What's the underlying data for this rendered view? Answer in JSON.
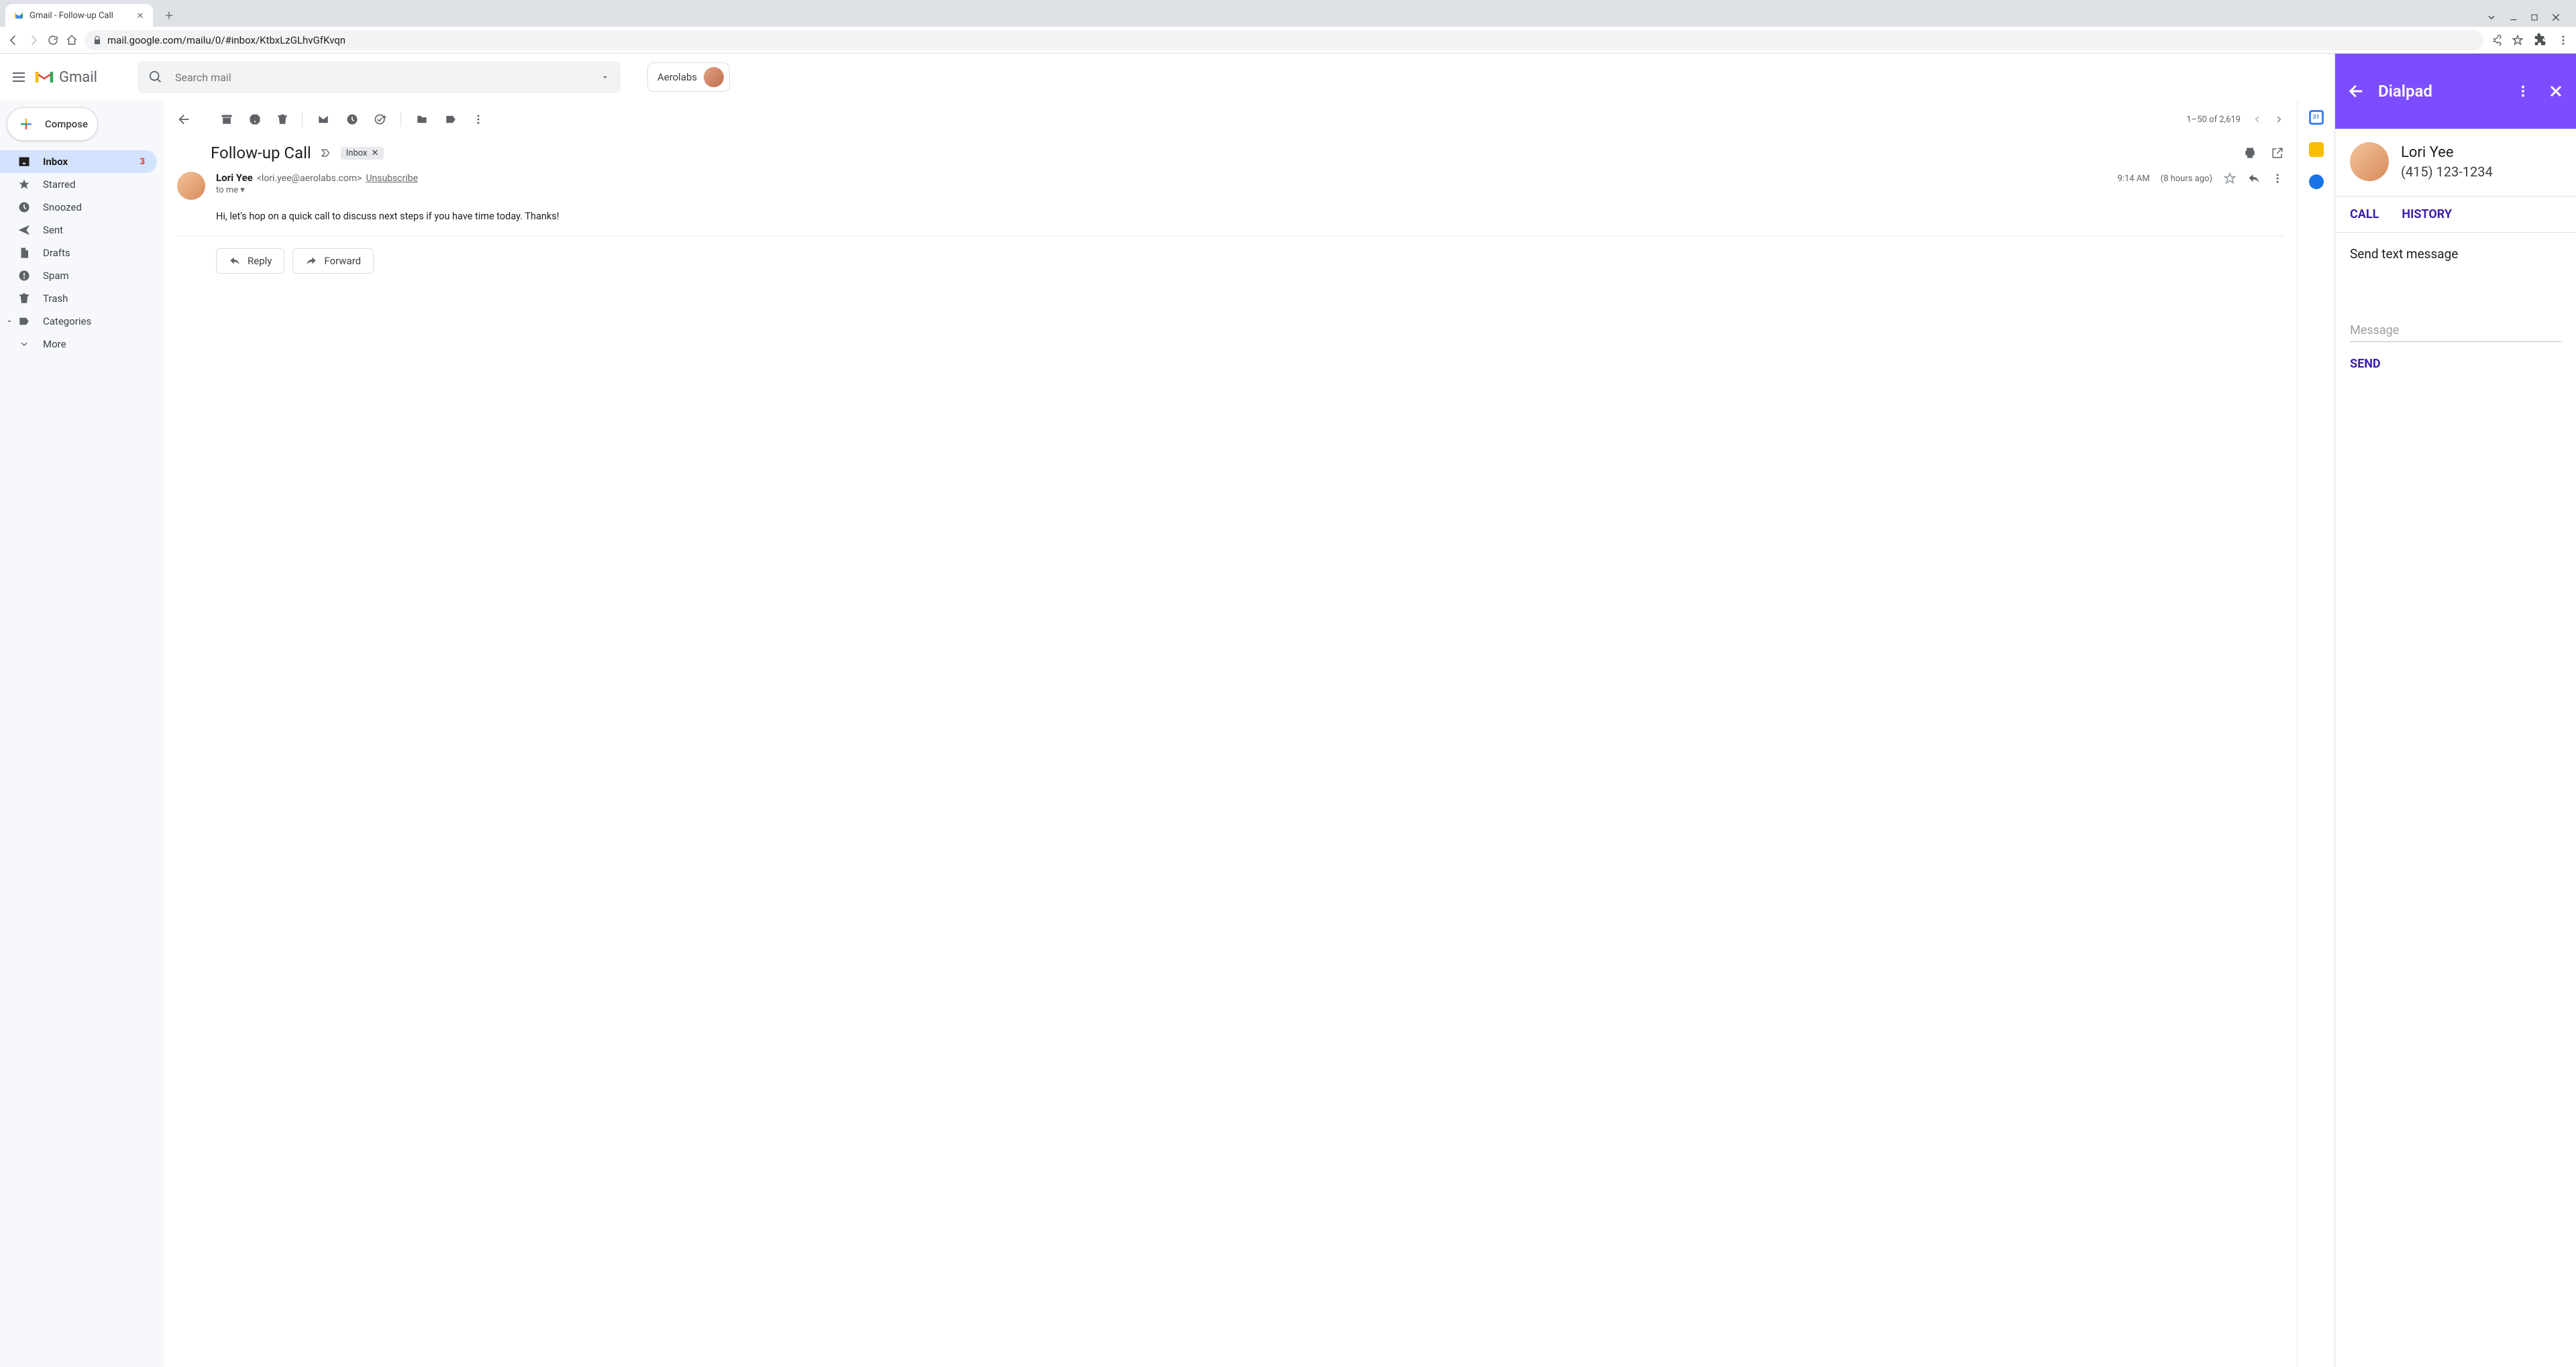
{
  "browser": {
    "tab_title": "Gmail - Follow-up Call",
    "url": "mail.google.com/mailu/0/#inbox/KtbxLzGLhvGfKvqn"
  },
  "gmail": {
    "product_name": "Gmail",
    "search_placeholder": "Search mail",
    "account_label": "Aerolabs",
    "compose_label": "Compose",
    "nav": {
      "inbox": "Inbox",
      "inbox_count": "3",
      "starred": "Starred",
      "snoozed": "Snoozed",
      "sent": "Sent",
      "drafts": "Drafts",
      "spam": "Spam",
      "trash": "Trash",
      "categories": "Categories",
      "more": "More"
    },
    "pagination": "1–50 of 2,619",
    "subject": "Follow-up Call",
    "subject_label": "Inbox",
    "sender_name": "Lori Yee",
    "sender_email": "<lori.yee@aerolabs.com>",
    "unsubscribe": "Unsubscribe",
    "to_line": "to  me",
    "time": "9:14 AM",
    "age": "(8 hours ago)",
    "body": "Hi, let's hop on a quick call to discuss next steps if you have time today. Thanks!",
    "reply_label": "Reply",
    "forward_label": "Forward"
  },
  "dialpad": {
    "title": "Dialpad",
    "contact_name": "Lori Yee",
    "contact_phone": "(415) 123-1234",
    "tab_call": "CALL",
    "tab_history": "HISTORY",
    "section_title": "Send text message",
    "message_placeholder": "Message",
    "send_label": "SEND"
  }
}
